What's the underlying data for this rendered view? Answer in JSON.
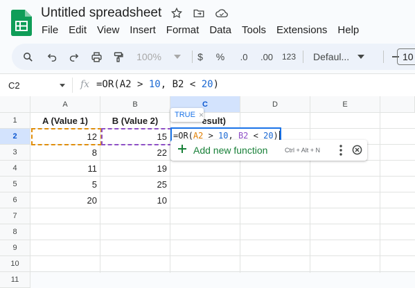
{
  "app": {
    "doc_title": "Untitled spreadsheet",
    "menu": [
      "File",
      "Edit",
      "View",
      "Insert",
      "Format",
      "Data",
      "Tools",
      "Extensions",
      "Help"
    ]
  },
  "toolbar": {
    "zoom": "100%",
    "currency": "$",
    "percent": "%",
    "decrease_decimal": ".0",
    "increase_decimal": ".00",
    "number_format": "123",
    "font": "Defaul...",
    "font_size": "10"
  },
  "formula_bar": {
    "cell_ref": "C2",
    "fx_label": "fx",
    "formula_plain": "=OR(",
    "formula_a2": "A2 > ",
    "formula_10": "10",
    "formula_sep": ", ",
    "formula_b2": "B2 < ",
    "formula_20": "20",
    "formula_close": ")"
  },
  "grid": {
    "columns": [
      "A",
      "B",
      "C",
      "D",
      "E"
    ],
    "rows": [
      "1",
      "2",
      "3",
      "4",
      "5",
      "6",
      "7",
      "8",
      "9",
      "10",
      "11"
    ],
    "header_row": {
      "A": "A (Value 1)",
      "B": "B (Value 2)",
      "C_tail": "esult)"
    },
    "data": [
      {
        "a": "12",
        "b": "15"
      },
      {
        "a": "8",
        "b": "22"
      },
      {
        "a": "11",
        "b": "19"
      },
      {
        "a": "5",
        "b": "25"
      },
      {
        "a": "20",
        "b": "10"
      }
    ],
    "editing": {
      "prefix": "=OR(",
      "a2": "A2",
      "gt": " > ",
      "ten": "10",
      "comma": ", ",
      "b2": "B2",
      "lt": " < ",
      "twenty": "20",
      "close": ")"
    },
    "preview_tooltip": "TRUE",
    "preview_close": "×"
  },
  "function_popup": {
    "add_label": "Add new function",
    "shortcut": "Ctrl + Alt + N"
  },
  "colors": {
    "accent": "#1a73e8",
    "green": "#188038",
    "a2_ref": "#e07e00",
    "b2_ref": "#8e4ec6"
  }
}
